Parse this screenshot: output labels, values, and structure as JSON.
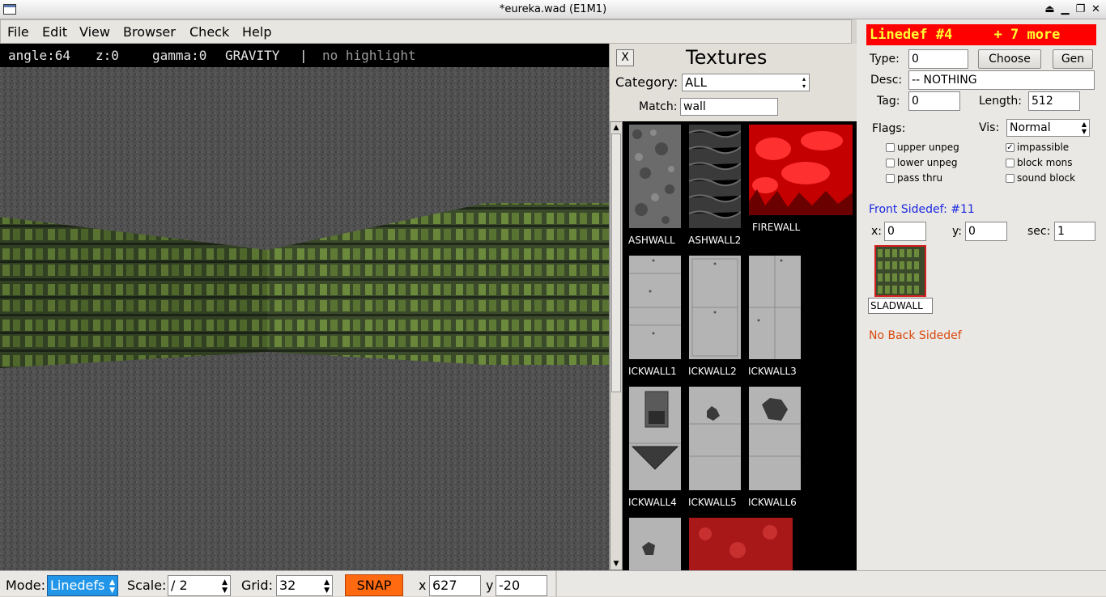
{
  "window": {
    "title": "*eureka.wad (E1M1)"
  },
  "menu": {
    "file": "File",
    "edit": "Edit",
    "view": "View",
    "browser": "Browser",
    "check": "Check",
    "help": "Help"
  },
  "info": {
    "angle": "angle:64",
    "z": "z:0",
    "gamma": "gamma:0",
    "gravity": "GRAVITY",
    "separator": "|",
    "highlight": "no highlight"
  },
  "textures": {
    "close_label": "X",
    "title": "Textures",
    "category_label": "Category:",
    "category_value": "ALL",
    "match_label": "Match:",
    "match_value": "wall",
    "items": [
      "ASHWALL",
      "ASHWALL2",
      "FIREWALL",
      "ICKWALL1",
      "ICKWALL2",
      "ICKWALL3",
      "ICKWALL4",
      "ICKWALL5",
      "ICKWALL6"
    ]
  },
  "linedef": {
    "header": "Linedef #4     + 7 more",
    "type_label": "Type:",
    "type_value": "0",
    "choose_label": "Choose",
    "gen_label": "Gen",
    "desc_label": "Desc:",
    "desc_value": "-- NOTHING",
    "tag_label": "Tag:",
    "tag_value": "0",
    "length_label": "Length:",
    "length_value": "512",
    "flags_label": "Flags:",
    "vis_label": "Vis:",
    "vis_value": "Normal",
    "flags": {
      "upper_unpeg": "upper unpeg",
      "impassible": "impassible",
      "lower_unpeg": "lower unpeg",
      "block_mons": "block mons",
      "pass_thru": "pass thru",
      "sound_block": "sound block"
    },
    "impassible_checked": true,
    "front_sidedef": "Front Sidedef: #11",
    "x_label": "x:",
    "x_value": "0",
    "y_label": "y:",
    "y_value": "0",
    "sec_label": "sec:",
    "sec_value": "1",
    "texture_name": "SLADWALL",
    "no_back": "No Back Sidedef"
  },
  "status": {
    "mode_label": "Mode:",
    "mode_value": "Linedefs",
    "scale_label": "Scale:",
    "scale_value": "/ 2",
    "grid_label": "Grid:",
    "grid_value": "32",
    "snap_label": "SNAP",
    "x_label": "x",
    "x_value": "627",
    "y_label": "y",
    "y_value": "-20"
  },
  "colors": {
    "header_bg": "#ff0000",
    "header_text": "#ffff33",
    "snap": "#ff6a10",
    "mode_select": "#2196e8",
    "sidedef_link": "#1a28e0",
    "no_back": "#d84a10"
  },
  "icons": {
    "window": "window-icon",
    "shade": "shade-icon",
    "minimize": "minimize-icon",
    "maximize": "maximize-icon",
    "close": "close-icon"
  }
}
